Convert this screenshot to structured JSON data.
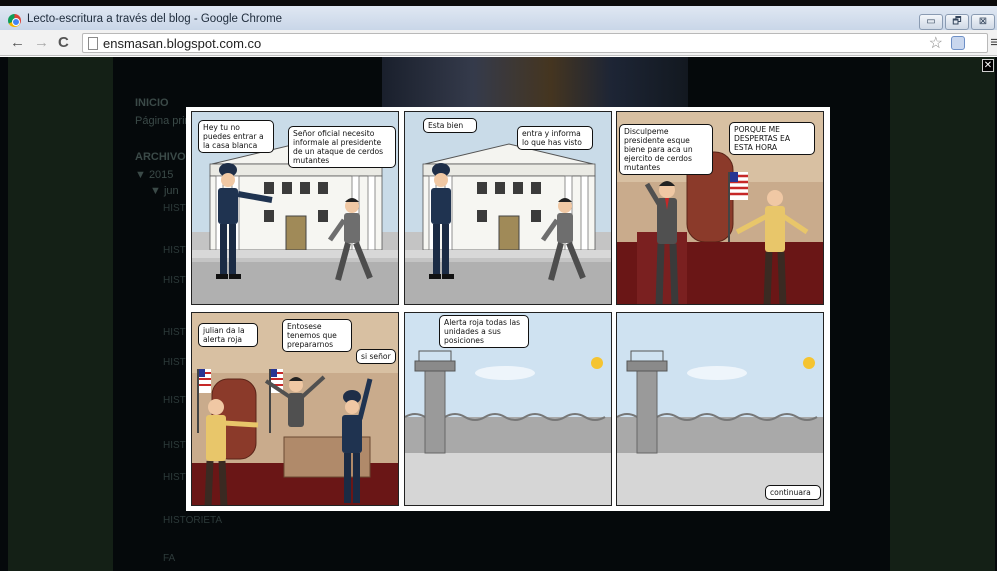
{
  "window": {
    "title": "Lecto-escritura a través del blog - Google Chrome",
    "buttons": {
      "minimize": "▭",
      "restore": "🗗",
      "close": "⊠"
    }
  },
  "toolbar": {
    "back": "←",
    "forward": "→",
    "reload": "C",
    "url": "ensmasan.blogspot.com.co",
    "star": "☆",
    "menu": "≡"
  },
  "blog_background": {
    "heading": "INICIO",
    "subtext": "Página principal",
    "archive_title": "ARCHIVO DEL BLOG",
    "year": "▼ 2015",
    "month": "▼ jun",
    "items": [
      "HISTORIETA",
      "HISTORIETA",
      "HISTORIETA",
      "HISTORIETA",
      "HISTORIETA",
      "HISTORIETA",
      "HISTORIETA",
      "HISTORIETA",
      "HISTORIETA",
      "FA"
    ]
  },
  "lightbox": {
    "close_label": "✕"
  },
  "comic": {
    "panels": [
      {
        "bubbles": [
          "Hey tu no puedes entrar a la casa blanca",
          "Señor oficial necesito informale al presidente de un ataque de cerdos mutantes"
        ]
      },
      {
        "bubbles": [
          "Esta bien",
          "entra y informa lo que has visto"
        ]
      },
      {
        "bubbles": [
          "Disculpeme presidente esque biene para aca un ejercito de cerdos mutantes",
          "PORQUE ME DESPERTAS EA ESTA HORA"
        ]
      },
      {
        "bubbles": [
          "julian da la alerta roja",
          "Entosese tenemos que prepararnos",
          "si señor"
        ]
      },
      {
        "bubbles": [
          "Alerta roja todas las unidades a sus posiciones"
        ]
      },
      {
        "bubbles": [
          "continuara"
        ]
      }
    ]
  },
  "colors": {
    "sky": "#bfd7ea",
    "building": "#f2f2ee",
    "police_uniform": "#1f3350",
    "floor_red": "#7a1f1f"
  }
}
